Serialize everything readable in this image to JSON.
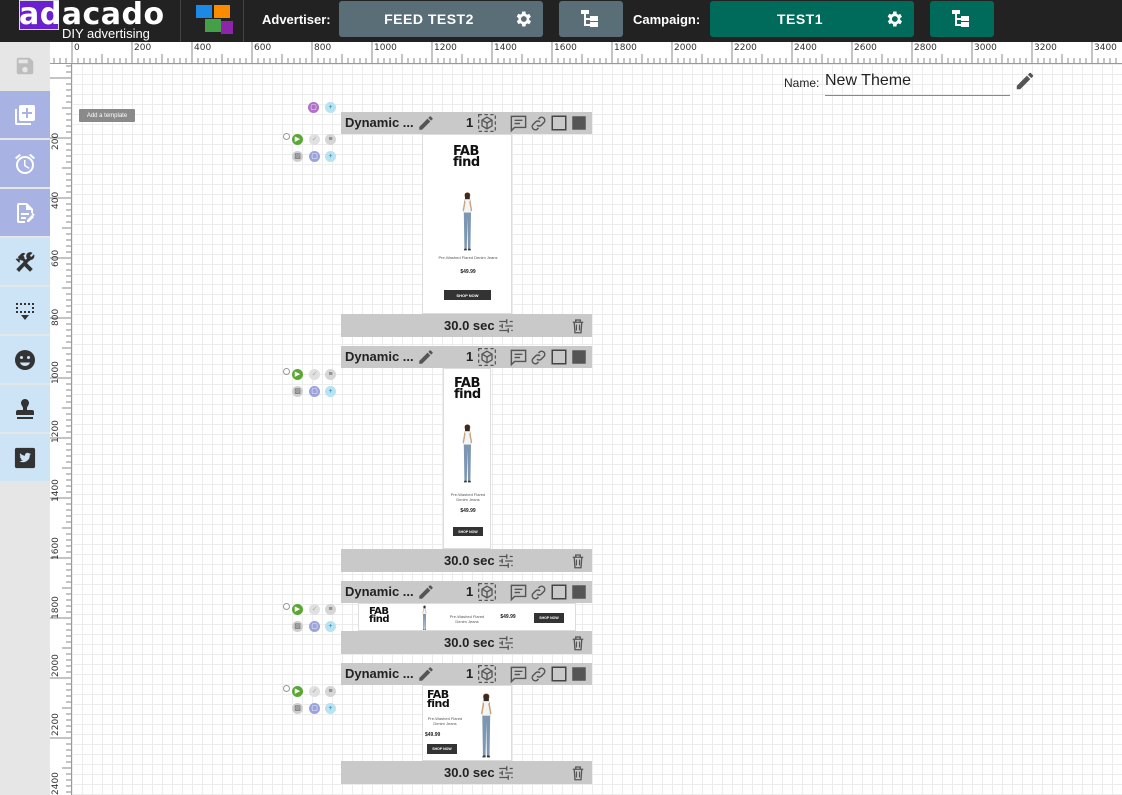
{
  "header": {
    "logo_text": "adacado",
    "logo_tagline": "DIY advertising",
    "advertiser_label": "Advertiser:",
    "advertiser_value": "FEED TEST2",
    "campaign_label": "Campaign:",
    "campaign_value": "TEST1",
    "colors": {
      "bar": "#222222",
      "advertiser_pill": "#5a6e78",
      "campaign_pill": "#006b5a",
      "logo_accent": "#6a1fd1"
    }
  },
  "sidebar": {
    "items": [
      {
        "icon": "save-icon"
      },
      {
        "icon": "add-template-icon"
      },
      {
        "icon": "alarm-icon"
      },
      {
        "icon": "edit-note-icon"
      },
      {
        "icon": "tools-icon"
      },
      {
        "icon": "select-area-icon"
      },
      {
        "icon": "smiley-icon"
      },
      {
        "icon": "stamp-icon"
      },
      {
        "icon": "twitter-icon"
      }
    ]
  },
  "ruler": {
    "top_labels": [
      "0",
      "200",
      "400",
      "600",
      "800",
      "1000",
      "1200",
      "1400",
      "1600",
      "1800",
      "2000",
      "2200",
      "2400",
      "2600",
      "2800",
      "3000",
      "3200",
      "3400"
    ],
    "left_labels": [
      "200",
      "400",
      "600",
      "800",
      "1000",
      "1200",
      "1400",
      "1600",
      "1800",
      "2000",
      "2200",
      "2400"
    ]
  },
  "theme": {
    "name_label": "Name:",
    "name_value": "New Theme"
  },
  "add_template_tooltip": "Add a template",
  "cards": [
    {
      "title": "Dynamic ...",
      "count": "1",
      "duration": "30.0 sec",
      "ad": {
        "brand_line1": "FAB",
        "brand_line2": "find",
        "product": "Pre-Washed Flared Denim Jeans",
        "price": "$49.99",
        "cta": "SHOP NOW"
      }
    },
    {
      "title": "Dynamic ...",
      "count": "1",
      "duration": "30.0 sec",
      "ad": {
        "brand_line1": "FAB",
        "brand_line2": "find",
        "product": "Pre-Washed Flared Denim Jeans",
        "price": "$49.99",
        "cta": "SHOP NOW"
      }
    },
    {
      "title": "Dynamic ...",
      "count": "1",
      "duration": "30.0 sec",
      "ad": {
        "brand_line1": "FAB",
        "brand_line2": "find",
        "product": "Pre-Washed Flared Denim Jeans",
        "price": "$49.99",
        "cta": "SHOP NOW"
      }
    },
    {
      "title": "Dynamic ...",
      "count": "1",
      "duration": "30.0 sec",
      "ad": {
        "brand_line1": "FAB",
        "brand_line2": "find",
        "product": "Pre-Washed Flared Denim Jeans",
        "price": "$49.99",
        "cta": "SHOP NOW"
      }
    }
  ]
}
